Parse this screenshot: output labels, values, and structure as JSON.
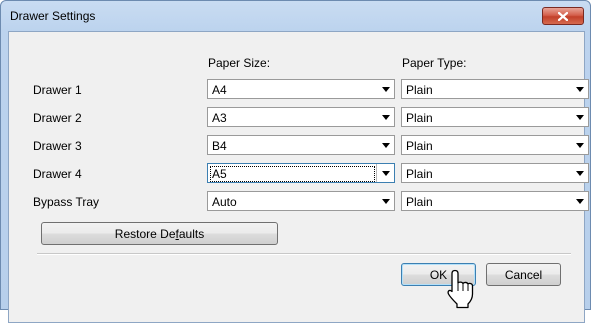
{
  "window": {
    "title": "Drawer Settings"
  },
  "headers": {
    "paper_size": "Paper Size:",
    "paper_type": "Paper Type:"
  },
  "rows": [
    {
      "label": "Drawer 1",
      "size": "A4",
      "type": "Plain"
    },
    {
      "label": "Drawer 2",
      "size": "A3",
      "type": "Plain"
    },
    {
      "label": "Drawer 3",
      "size": "B4",
      "type": "Plain"
    },
    {
      "label": "Drawer 4",
      "size": "A5",
      "type": "Plain"
    },
    {
      "label": "Bypass Tray",
      "size": "Auto",
      "type": "Plain"
    }
  ],
  "buttons": {
    "restore_prefix": "Restore De",
    "restore_accel": "f",
    "restore_suffix": "aults",
    "ok": "OK",
    "cancel": "Cancel"
  },
  "icons": {
    "close": "close-icon",
    "dropdown": "chevron-down-icon",
    "cursor": "mouse-pointer-icon"
  },
  "colors": {
    "title_bar": "#bcd3ee",
    "close_button": "#c2402a",
    "dialog_bg": "#f0f0f0",
    "focus_border": "#3c7fb1"
  }
}
